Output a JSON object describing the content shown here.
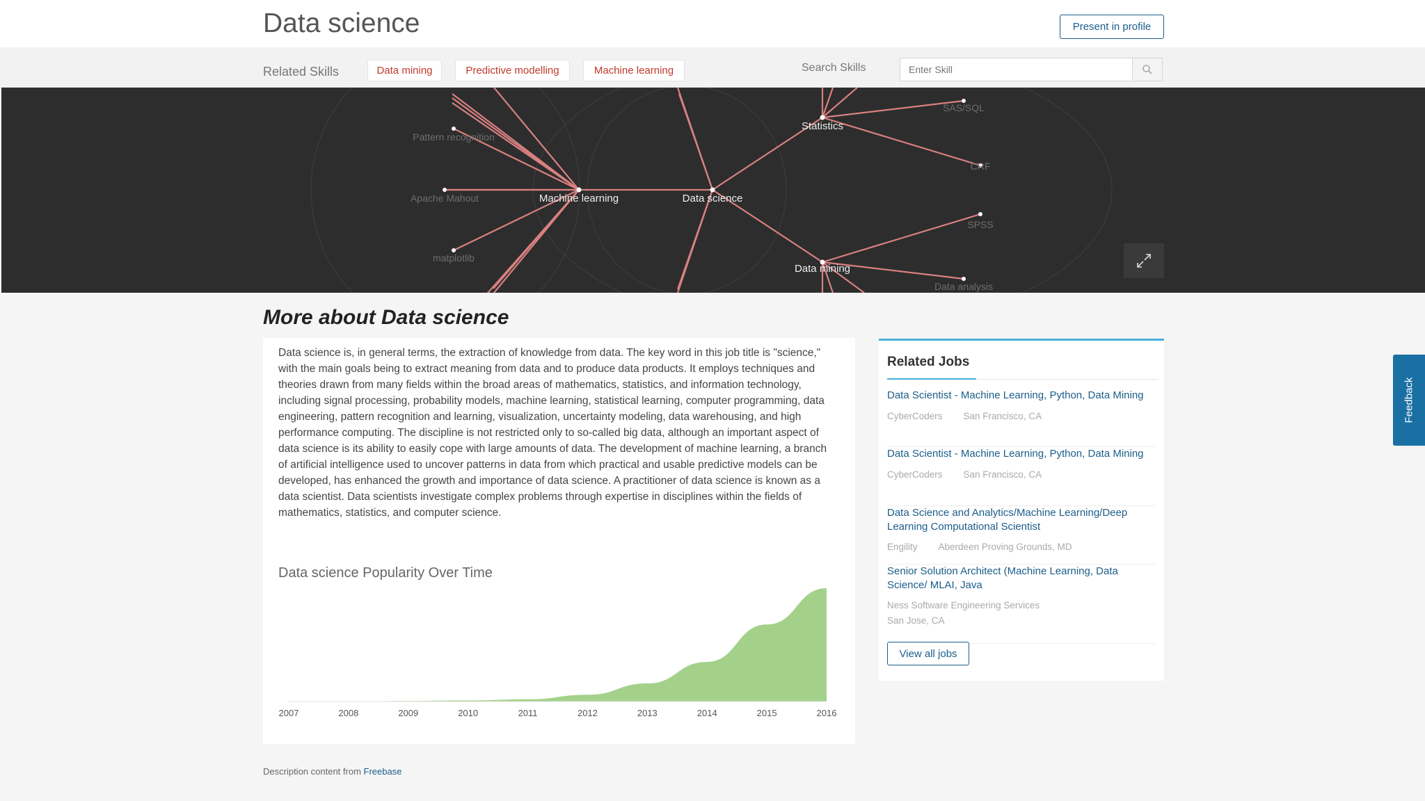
{
  "header": {
    "title": "Data science",
    "present_button": "Present in profile"
  },
  "skills_bar": {
    "related_label": "Related Skills",
    "tags": [
      "Data mining",
      "Predictive modelling",
      "Machine learning"
    ],
    "search_label": "Search Skills",
    "search_placeholder": "Enter Skill"
  },
  "skill_graph": {
    "center": "Data science",
    "nodes": [
      "Machine learning",
      "Statistics",
      "Data mining",
      "Pattern recognition",
      "Apache Mahout",
      "matplotlib",
      "SAS/SQL",
      "CRF",
      "SPSS",
      "Data analysis"
    ]
  },
  "about": {
    "title": "More about Data science",
    "description": "Data science is, in general terms, the extraction of knowledge from data. The key word in this job title is \"science,\" with the main goals being to extract meaning from data and to produce data products. It employs techniques and theories drawn from many fields within the broad areas of mathematics, statistics, and information technology, including signal processing, probability models, machine learning, statistical learning, computer programming, data engineering, pattern recognition and learning, visualization, uncertainty modeling, data warehousing, and high performance computing. The discipline is not restricted only to so-called big data, although an important aspect of data science is its ability to easily cope with large amounts of data. The development of machine learning, a branch of artificial intelligence used to uncover patterns in data from which practical and usable predictive models can be developed, has enhanced the growth and importance of data science. A practitioner of data science is known as a data scientist. Data scientists investigate complex problems through expertise in disciplines within the fields of mathematics, statistics, and computer science.",
    "chart_title": "Data science Popularity Over Time"
  },
  "chart_data": {
    "type": "area",
    "title": "Data science Popularity Over Time",
    "x": [
      "2007",
      "2008",
      "2009",
      "2010",
      "2011",
      "2012",
      "2013",
      "2014",
      "2015",
      "2016"
    ],
    "values": [
      0,
      0,
      0.5,
      1,
      2,
      6,
      16,
      35,
      68,
      100
    ],
    "ylim": [
      0,
      100
    ],
    "color": "#a3d18a",
    "grid": false
  },
  "source": {
    "prefix": "Description content from ",
    "link": "Freebase"
  },
  "related_jobs": {
    "title": "Related Jobs",
    "jobs": [
      {
        "title": "Data Scientist - Machine Learning, Python, Data Mining",
        "company": "CyberCoders",
        "location": "San Francisco, CA"
      },
      {
        "title": "Data Scientist - Machine Learning, Python, Data Mining",
        "company": "CyberCoders",
        "location": "San Francisco, CA"
      },
      {
        "title": "Data Science and Analytics/Machine Learning/Deep Learning Computational Scientist",
        "company": "Engility",
        "location": "Aberdeen Proving Grounds, MD"
      },
      {
        "title": "Senior Solution Architect (Machine Learning, Data Science/ MLAI, Java",
        "company": "Ness Software Engineering Services",
        "location": "San Jose, CA"
      }
    ],
    "view_all": "View all jobs"
  },
  "feedback": "Feedback",
  "colors": {
    "link": "#1a5e8a",
    "accent": "#47b0d8",
    "tag_text": "#c0392b",
    "graph_bg": "#2d2d2d",
    "edge": "#d98080",
    "area": "#a3d18a"
  }
}
